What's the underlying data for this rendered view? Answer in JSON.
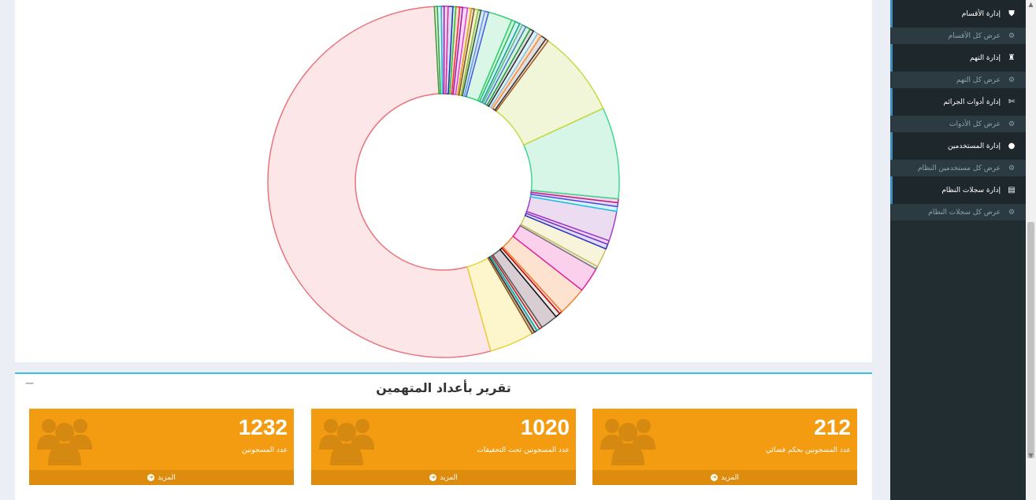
{
  "chart_data": {
    "type": "pie",
    "variant": "doughnut",
    "slices": [
      {
        "value": 60.4,
        "color": "#e8747c",
        "fill": "#fde6e8"
      },
      {
        "value": 4.6,
        "color": "#e8d23c",
        "fill": "#fdf6cc"
      },
      {
        "value": 0.3,
        "color": "#8b5a2b",
        "fill": "#d2b48c"
      },
      {
        "value": 0.3,
        "color": "#2f2f2f",
        "fill": "#cccccc"
      },
      {
        "value": 0.3,
        "color": "#0aa",
        "fill": "#d0f5f5"
      },
      {
        "value": 0.3,
        "color": "#b22",
        "fill": "#f5d0d0"
      },
      {
        "value": 1.8,
        "color": "#5a5a5a",
        "fill": "#d8cdd3"
      },
      {
        "value": 0.5,
        "color": "#111",
        "fill": "#e6e6e6"
      },
      {
        "value": 0.3,
        "color": "#c00",
        "fill": "#fcdede"
      },
      {
        "value": 3.0,
        "color": "#f08030",
        "fill": "#fde3cf"
      },
      {
        "value": 2.6,
        "color": "#e020a0",
        "fill": "#fbd0ec"
      },
      {
        "value": 0.3,
        "color": "#777",
        "fill": "#eee"
      },
      {
        "value": 2.0,
        "color": "#c8c060",
        "fill": "#f8f4dc"
      },
      {
        "value": 0.5,
        "color": "#3030c0",
        "fill": "#dedef8"
      },
      {
        "value": 0.4,
        "color": "#8030c0",
        "fill": "#ead8f6"
      },
      {
        "value": 3.1,
        "color": "#a040c0",
        "fill": "#ecdcf2"
      },
      {
        "value": 0.5,
        "color": "#20c0e0",
        "fill": "#d6f4fb"
      },
      {
        "value": 0.4,
        "color": "#6040e0",
        "fill": "#e0dcfa"
      },
      {
        "value": 0.4,
        "color": "#c02080",
        "fill": "#f6d6e8"
      },
      {
        "value": 9.5,
        "color": "#40d890",
        "fill": "#d8f6e8"
      },
      {
        "value": 9.0,
        "color": "#c8d840",
        "fill": "#f2f6d8"
      },
      {
        "value": 0.3,
        "color": "#a05a2c",
        "fill": "#f0dcc8"
      },
      {
        "value": 0.6,
        "color": "#333",
        "fill": "#e0e0e0"
      },
      {
        "value": 0.4,
        "color": "#ff9040",
        "fill": "#fde4d0"
      },
      {
        "value": 0.5,
        "color": "#80c0e0",
        "fill": "#e0f0f8"
      },
      {
        "value": 0.4,
        "color": "#2a2a2a",
        "fill": "#dcdcdc"
      },
      {
        "value": 0.5,
        "color": "#20a040",
        "fill": "#d6f2dc"
      },
      {
        "value": 0.4,
        "color": "#4080c0",
        "fill": "#dce8f6"
      },
      {
        "value": 0.3,
        "color": "#60c080",
        "fill": "#dcf2e4"
      },
      {
        "value": 0.5,
        "color": "#10a0a0",
        "fill": "#d4f0f0"
      },
      {
        "value": 0.4,
        "color": "#20c060",
        "fill": "#d6f6e2"
      },
      {
        "value": 2.5,
        "color": "#30d070",
        "fill": "#daf6e6"
      },
      {
        "value": 0.4,
        "color": "#4060e0",
        "fill": "#dce2fa"
      },
      {
        "value": 0.4,
        "color": "#60a0e0",
        "fill": "#dceafa"
      },
      {
        "value": 0.3,
        "color": "#306030",
        "fill": "#d8e8d8"
      },
      {
        "value": 0.4,
        "color": "#a0c030",
        "fill": "#eef4d8"
      },
      {
        "value": 0.3,
        "color": "#805020",
        "fill": "#f0e0cc"
      },
      {
        "value": 0.4,
        "color": "#e0a020",
        "fill": "#fbecd0"
      },
      {
        "value": 0.5,
        "color": "#e040e0",
        "fill": "#f8d8f8"
      },
      {
        "value": 0.3,
        "color": "#a020a0",
        "fill": "#f0d6f0"
      },
      {
        "value": 0.4,
        "color": "#f03030",
        "fill": "#fcd8d8"
      },
      {
        "value": 0.3,
        "color": "#30c030",
        "fill": "#d8f4d8"
      },
      {
        "value": 0.5,
        "color": "#2030c0",
        "fill": "#d8dcf6"
      },
      {
        "value": 0.4,
        "color": "#e030a0",
        "fill": "#f8d6ec"
      },
      {
        "value": 0.3,
        "color": "#9020c0",
        "fill": "#ecd6f6"
      },
      {
        "value": 0.4,
        "color": "#20c0c0",
        "fill": "#d6f4f4"
      },
      {
        "value": 0.3,
        "color": "#40a040",
        "fill": "#dcf0dc"
      }
    ]
  },
  "report": {
    "title": "تقرير بأعداد المتهمين",
    "collapse_symbol": "−",
    "cards": [
      {
        "number": "1232",
        "label": "عدد المسجونين",
        "more": "المزيد"
      },
      {
        "number": "1020",
        "label": "عدد المسجونين تحت التحقيقات",
        "more": "المزيد"
      },
      {
        "number": "212",
        "label": "عدد المسجونين بحكم قضائي",
        "more": "المزيد"
      }
    ]
  },
  "sidebar": {
    "items": [
      {
        "label": "إدارة الأقسام",
        "icon": "shield-icon"
      },
      {
        "label": "عرض كل الأقسام",
        "icon": "cogs-icon"
      },
      {
        "label": "إدارة التهم",
        "icon": "user-secret-icon"
      },
      {
        "label": "عرض كل التهم",
        "icon": "cogs-icon"
      },
      {
        "label": "إدارة أدوات الجرائم",
        "icon": "tools-icon"
      },
      {
        "label": "عرض كل الأدوات",
        "icon": "cogs-icon"
      },
      {
        "label": "إدارة المستخدمين",
        "icon": "user-icon"
      },
      {
        "label": "عرض كل مستخدمين النظام",
        "icon": "cogs-icon"
      },
      {
        "label": "إدارة سجلات النظام",
        "icon": "id-card-icon"
      },
      {
        "label": "عرض كل سجلات النظام",
        "icon": "cogs-icon"
      }
    ]
  },
  "colors": {
    "card_bg": "#f39c12",
    "card_footer": "#dd8c0e",
    "sidebar_bg": "#222d32",
    "accent": "#3c8dbc"
  }
}
